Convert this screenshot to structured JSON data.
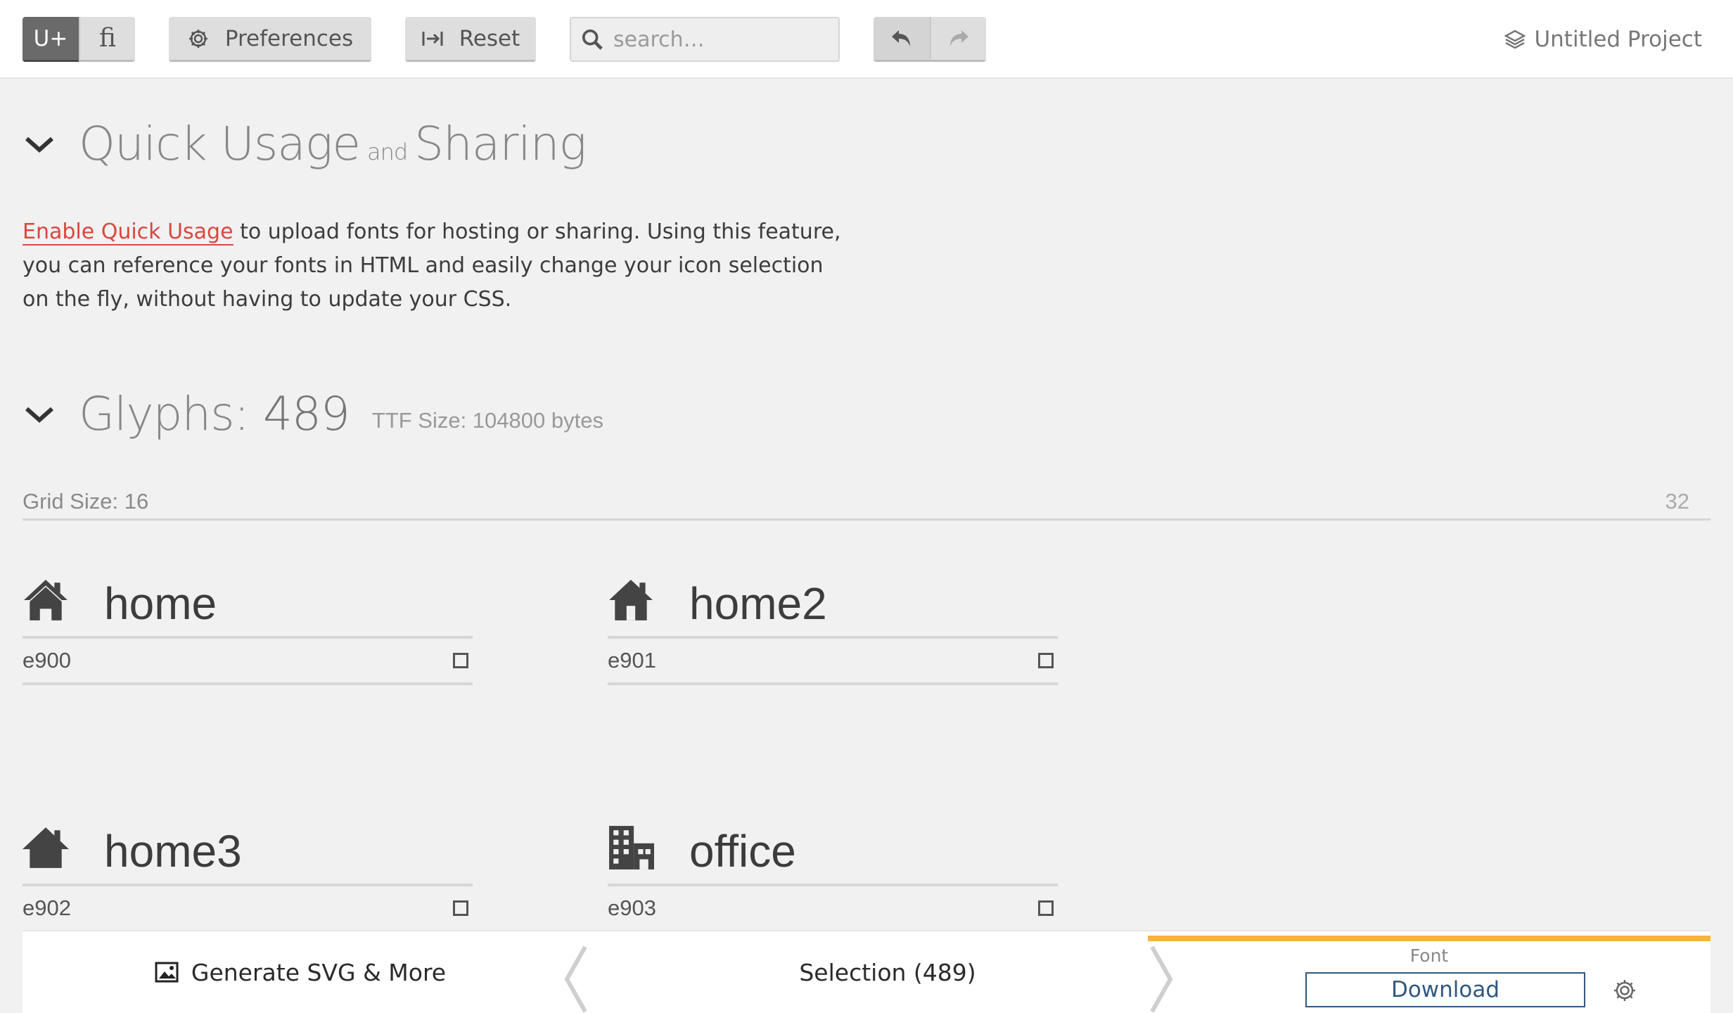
{
  "toolbar": {
    "unicode_mode_label": "U+",
    "ligature_mode_label": "fi",
    "preferences_label": "Preferences",
    "reset_label": "Reset",
    "search_placeholder": "search…",
    "project_name": "Untitled Project"
  },
  "quick_usage": {
    "title_part1": "Quick Usage",
    "title_connector": "and",
    "title_part2": "Sharing",
    "enable_link": "Enable Quick Usage",
    "description": " to upload fonts for hosting or sharing. Using this feature, you can reference your fonts in HTML and easily change your icon selection on the fly, without having to update your CSS."
  },
  "glyphs": {
    "title_prefix": "Glyphs:",
    "count": "489",
    "ttf_size": "TTF Size: 104800 bytes",
    "grid_size_label": "Grid Size: 16",
    "grid_max": "32",
    "items": [
      {
        "name": "home",
        "code": "e900",
        "icon": "home-icon"
      },
      {
        "name": "home2",
        "code": "e901",
        "icon": "home2-icon"
      },
      {
        "name": "home3",
        "code": "e902",
        "icon": "home3-icon"
      },
      {
        "name": "office",
        "code": "e903",
        "icon": "office-icon"
      }
    ]
  },
  "bottombar": {
    "generate_label": "Generate SVG & More",
    "selection_label": "Selection (489)",
    "font_caption": "Font",
    "download_label": "Download"
  },
  "colors": {
    "accent_link": "#d9473f",
    "download_accent": "#31577f",
    "font_tab_highlight": "#f6b33e"
  }
}
